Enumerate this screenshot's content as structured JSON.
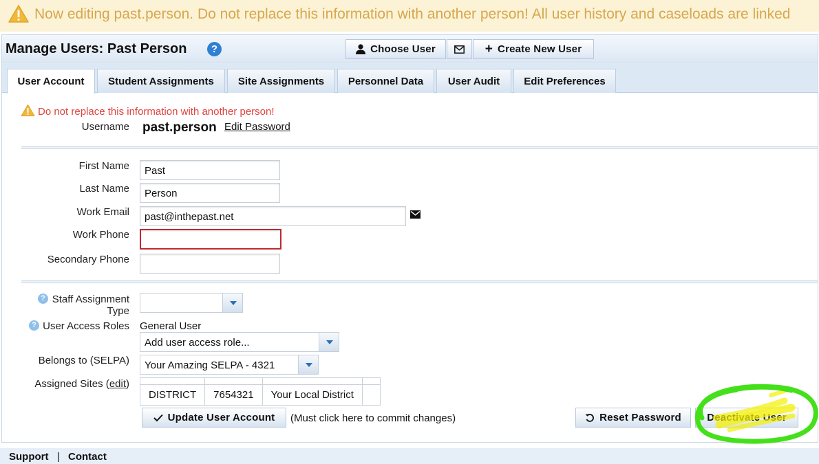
{
  "banner": {
    "text": "Now editing past.person. Do not replace this information with another person! All user history and caseloads are linked"
  },
  "header": {
    "title": "Manage Users: Past Person",
    "help": "?",
    "choose_user": "Choose User",
    "create_new_user": "Create New User"
  },
  "tabs": [
    {
      "label": "User Account",
      "active": true
    },
    {
      "label": "Student Assignments"
    },
    {
      "label": "Site Assignments"
    },
    {
      "label": "Personnel Data"
    },
    {
      "label": "User Audit"
    },
    {
      "label": "Edit Preferences"
    }
  ],
  "account": {
    "warning": "Do not replace this information with another person!",
    "username_label": "Username",
    "username": "past.person",
    "edit_password": "Edit Password"
  },
  "fields": {
    "first_name_label": "First Name",
    "first_name": "Past",
    "last_name_label": "Last Name",
    "last_name": "Person",
    "work_email_label": "Work Email",
    "work_email": "past@inthepast.net",
    "work_phone_label": "Work Phone",
    "work_phone": "",
    "secondary_phone_label": "Secondary Phone",
    "secondary_phone": ""
  },
  "assignment": {
    "staff_type_label_1": "Staff Assignment",
    "staff_type_label_2": "Type",
    "staff_type_value": "",
    "roles_label": "User Access Roles",
    "roles_current": "General User",
    "roles_placeholder": "Add user access role...",
    "selpa_label": "Belongs to (SELPA)",
    "selpa_value": "Your Amazing SELPA - 4321",
    "sites_label": "Assigned Sites (",
    "sites_edit": "edit",
    "sites_label_end": ")",
    "sites": [
      {
        "type": "DISTRICT",
        "code": "7654321",
        "name": "Your Local District"
      }
    ]
  },
  "actions": {
    "update": "Update User Account",
    "update_note": "(Must click here to commit changes)",
    "reset_password": "Reset Password",
    "deactivate": "Deactivate User"
  },
  "footer": {
    "support": "Support",
    "separator": "|",
    "contact": "Contact"
  },
  "colors": {
    "banner_bg": "#fcf3d6",
    "banner_text": "#d6a74e",
    "warning_red": "#e0413d",
    "error_border": "#c0282d",
    "highlight_green": "#44e01a",
    "highlight_yellow": "#f4f000"
  }
}
